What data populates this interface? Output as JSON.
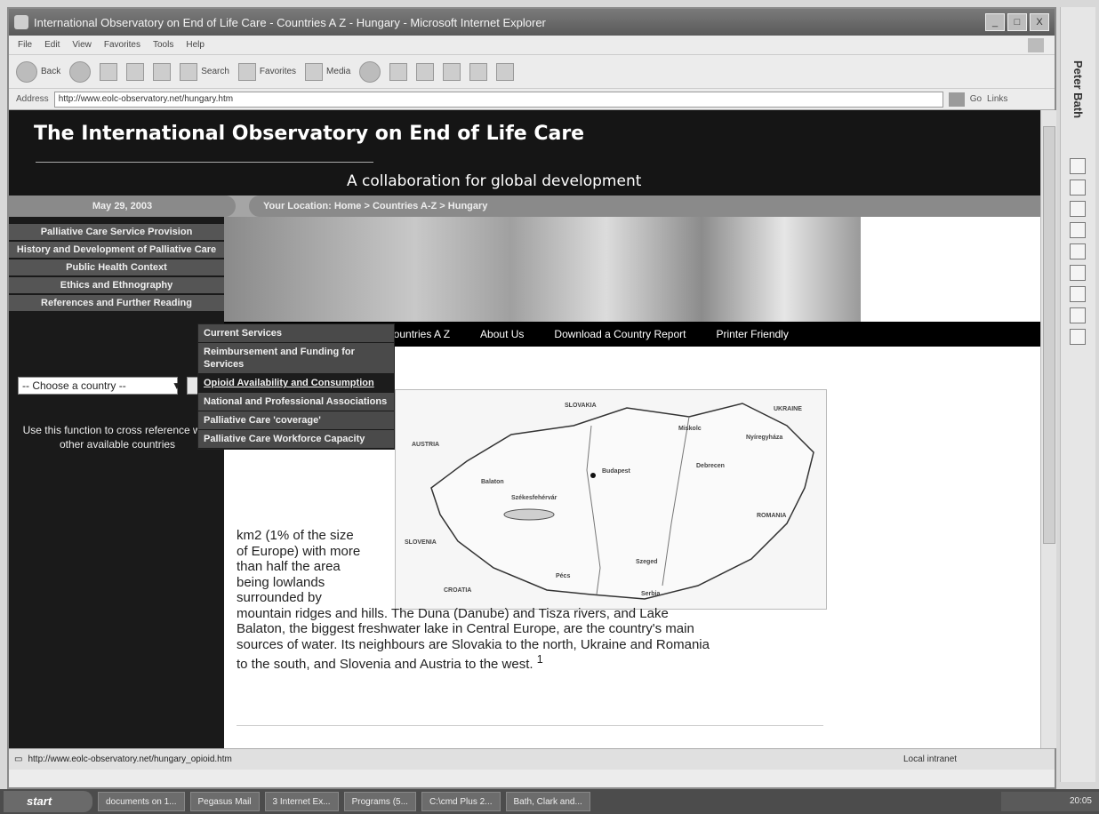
{
  "window": {
    "title": "International Observatory on End of Life Care - Countries A Z - Hungary - Microsoft Internet Explorer",
    "buttons": [
      "_",
      "□",
      "X"
    ]
  },
  "menubar": [
    "File",
    "Edit",
    "View",
    "Favorites",
    "Tools",
    "Help"
  ],
  "toolbar": {
    "back": "Back",
    "search": "Search",
    "favorites": "Favorites",
    "media": "Media"
  },
  "address": {
    "label": "Address",
    "url": "http://www.eolc-observatory.net/hungary.htm",
    "go": "Go",
    "links": "Links"
  },
  "site": {
    "title": "The International Observatory on End of Life Care",
    "tagline": "A collaboration for global development",
    "date": "May 29, 2003",
    "location": "Your Location: Home > Countries A-Z > Hungary"
  },
  "side_menu": [
    "Palliative Care Service Provision",
    "History and Development of Palliative Care",
    "Public Health Context",
    "Ethics and Ethnography",
    "References and Further Reading"
  ],
  "country_select": {
    "value": "-- Choose a country --"
  },
  "side_help": "Use this function to cross reference with other available countries",
  "nav": [
    "Countries A Z",
    "About Us",
    "Download a Country Report",
    "Printer Friendly"
  ],
  "dropdown": [
    "Current Services",
    "Reimbursement and Funding for Services",
    "Opioid Availability and Consumption",
    "National and Professional Associations",
    "Palliative Care 'coverage'",
    "Palliative Care Workforce Capacity"
  ],
  "map_labels": {
    "slovakia": "SLOVAKIA",
    "ukraine": "UKRAINE",
    "austria": "AUSTRIA",
    "romania": "ROMANIA",
    "slovenia": "SLOVENIA",
    "croatia": "CROATIA",
    "serbia": "Serbia",
    "budapest": "Budapest",
    "miskolc": "Miskolc",
    "debrecen": "Debrecen",
    "szeged": "Szeged",
    "pecs": "Pécs",
    "szekesfehervar": "Székesfehérvár",
    "nyiregyhaza": "Nyíregyháza",
    "balaton": "Balaton"
  },
  "article": {
    "narrow_lines": [
      "km2 (1% of the size",
      "of Europe) with more",
      "than half the area",
      "being lowlands",
      "surrounded by"
    ],
    "wide_lines": [
      "mountain ridges and hills. The Duna (Danube) and Tisza rivers, and Lake",
      "Balaton, the biggest freshwater lake in Central Europe, are the country's main",
      "sources of water. Its neighbours are Slovakia to the north, Ukraine and Romania",
      "to the south, and Slovenia and Austria to the west."
    ],
    "footnote": "1"
  },
  "status": {
    "url": "http://www.eolc-observatory.net/hungary_opioid.htm",
    "zone": "Local intranet"
  },
  "taskbar": {
    "start": "start",
    "tasks": [
      "documents on 1...",
      "Pegasus Mail",
      "3 Internet Ex...",
      "Programs (5...",
      "C:\\cmd Plus 2...",
      "Bath, Clark and..."
    ],
    "clock": "20:05"
  },
  "side_toolbar": {
    "user": "Peter Bath"
  }
}
